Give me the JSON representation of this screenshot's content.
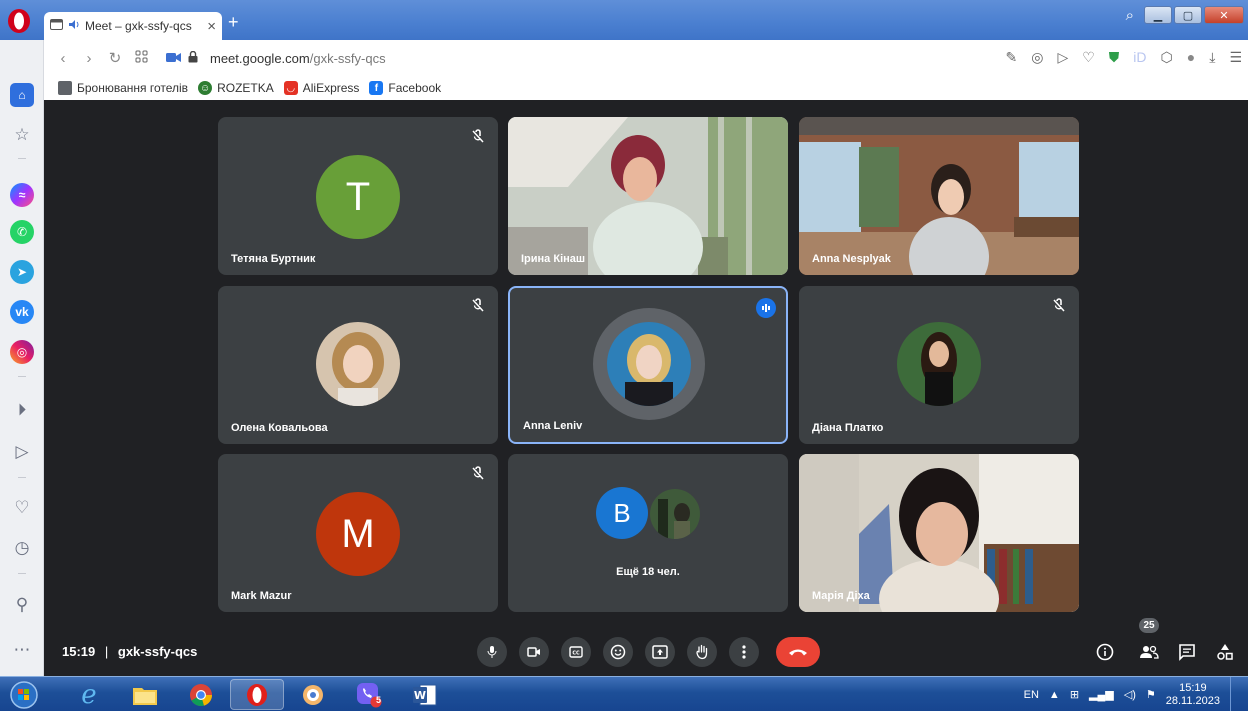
{
  "browser": {
    "tab_title": "Meet – gxk-ssfy-qcs",
    "url_domain": "meet.google.com",
    "url_path": "/gxk-ssfy-qcs",
    "bookmarks": [
      {
        "label": "Бронювання готелів",
        "icon": "folder-icon",
        "color": "#5f6368"
      },
      {
        "label": "ROZETKA",
        "icon": "rozetka-icon",
        "color": "#2e7d32"
      },
      {
        "label": "AliExpress",
        "icon": "aliexpress-icon",
        "color": "#e43225"
      },
      {
        "label": "Facebook",
        "icon": "facebook-icon",
        "color": "#1877f2"
      }
    ]
  },
  "meet": {
    "participants": [
      {
        "name": "Тетяна Буртник",
        "initial": "T",
        "avatar_color": "#689f38",
        "muted": true,
        "type": "initial"
      },
      {
        "name": "Ірина Кінаш",
        "muted": false,
        "type": "video"
      },
      {
        "name": "Anna Nesplyak",
        "muted": false,
        "type": "video"
      },
      {
        "name": "Олена Ковальова",
        "muted": true,
        "type": "photo"
      },
      {
        "name": "Anna Leniv",
        "muted": false,
        "type": "photo",
        "speaking": true
      },
      {
        "name": "Діана Платко",
        "muted": true,
        "type": "photo"
      },
      {
        "name": "Mark Mazur",
        "initial": "M",
        "avatar_color": "#bf360c",
        "muted": true,
        "type": "initial"
      },
      {
        "name": "Ещё 18 чел.",
        "initial": "B",
        "avatar_color": "#1976d2",
        "type": "overflow"
      },
      {
        "name": "Марія Діха",
        "muted": false,
        "type": "video"
      }
    ],
    "time": "15:19",
    "separator": "|",
    "meeting_code": "gxk-ssfy-qcs",
    "people_count": "25",
    "accent_color": "#8ab4f8",
    "end_call_color": "#ea4335"
  },
  "taskbar": {
    "language": "EN",
    "time": "15:19",
    "date": "28.11.2023",
    "viber_badge": "5"
  }
}
